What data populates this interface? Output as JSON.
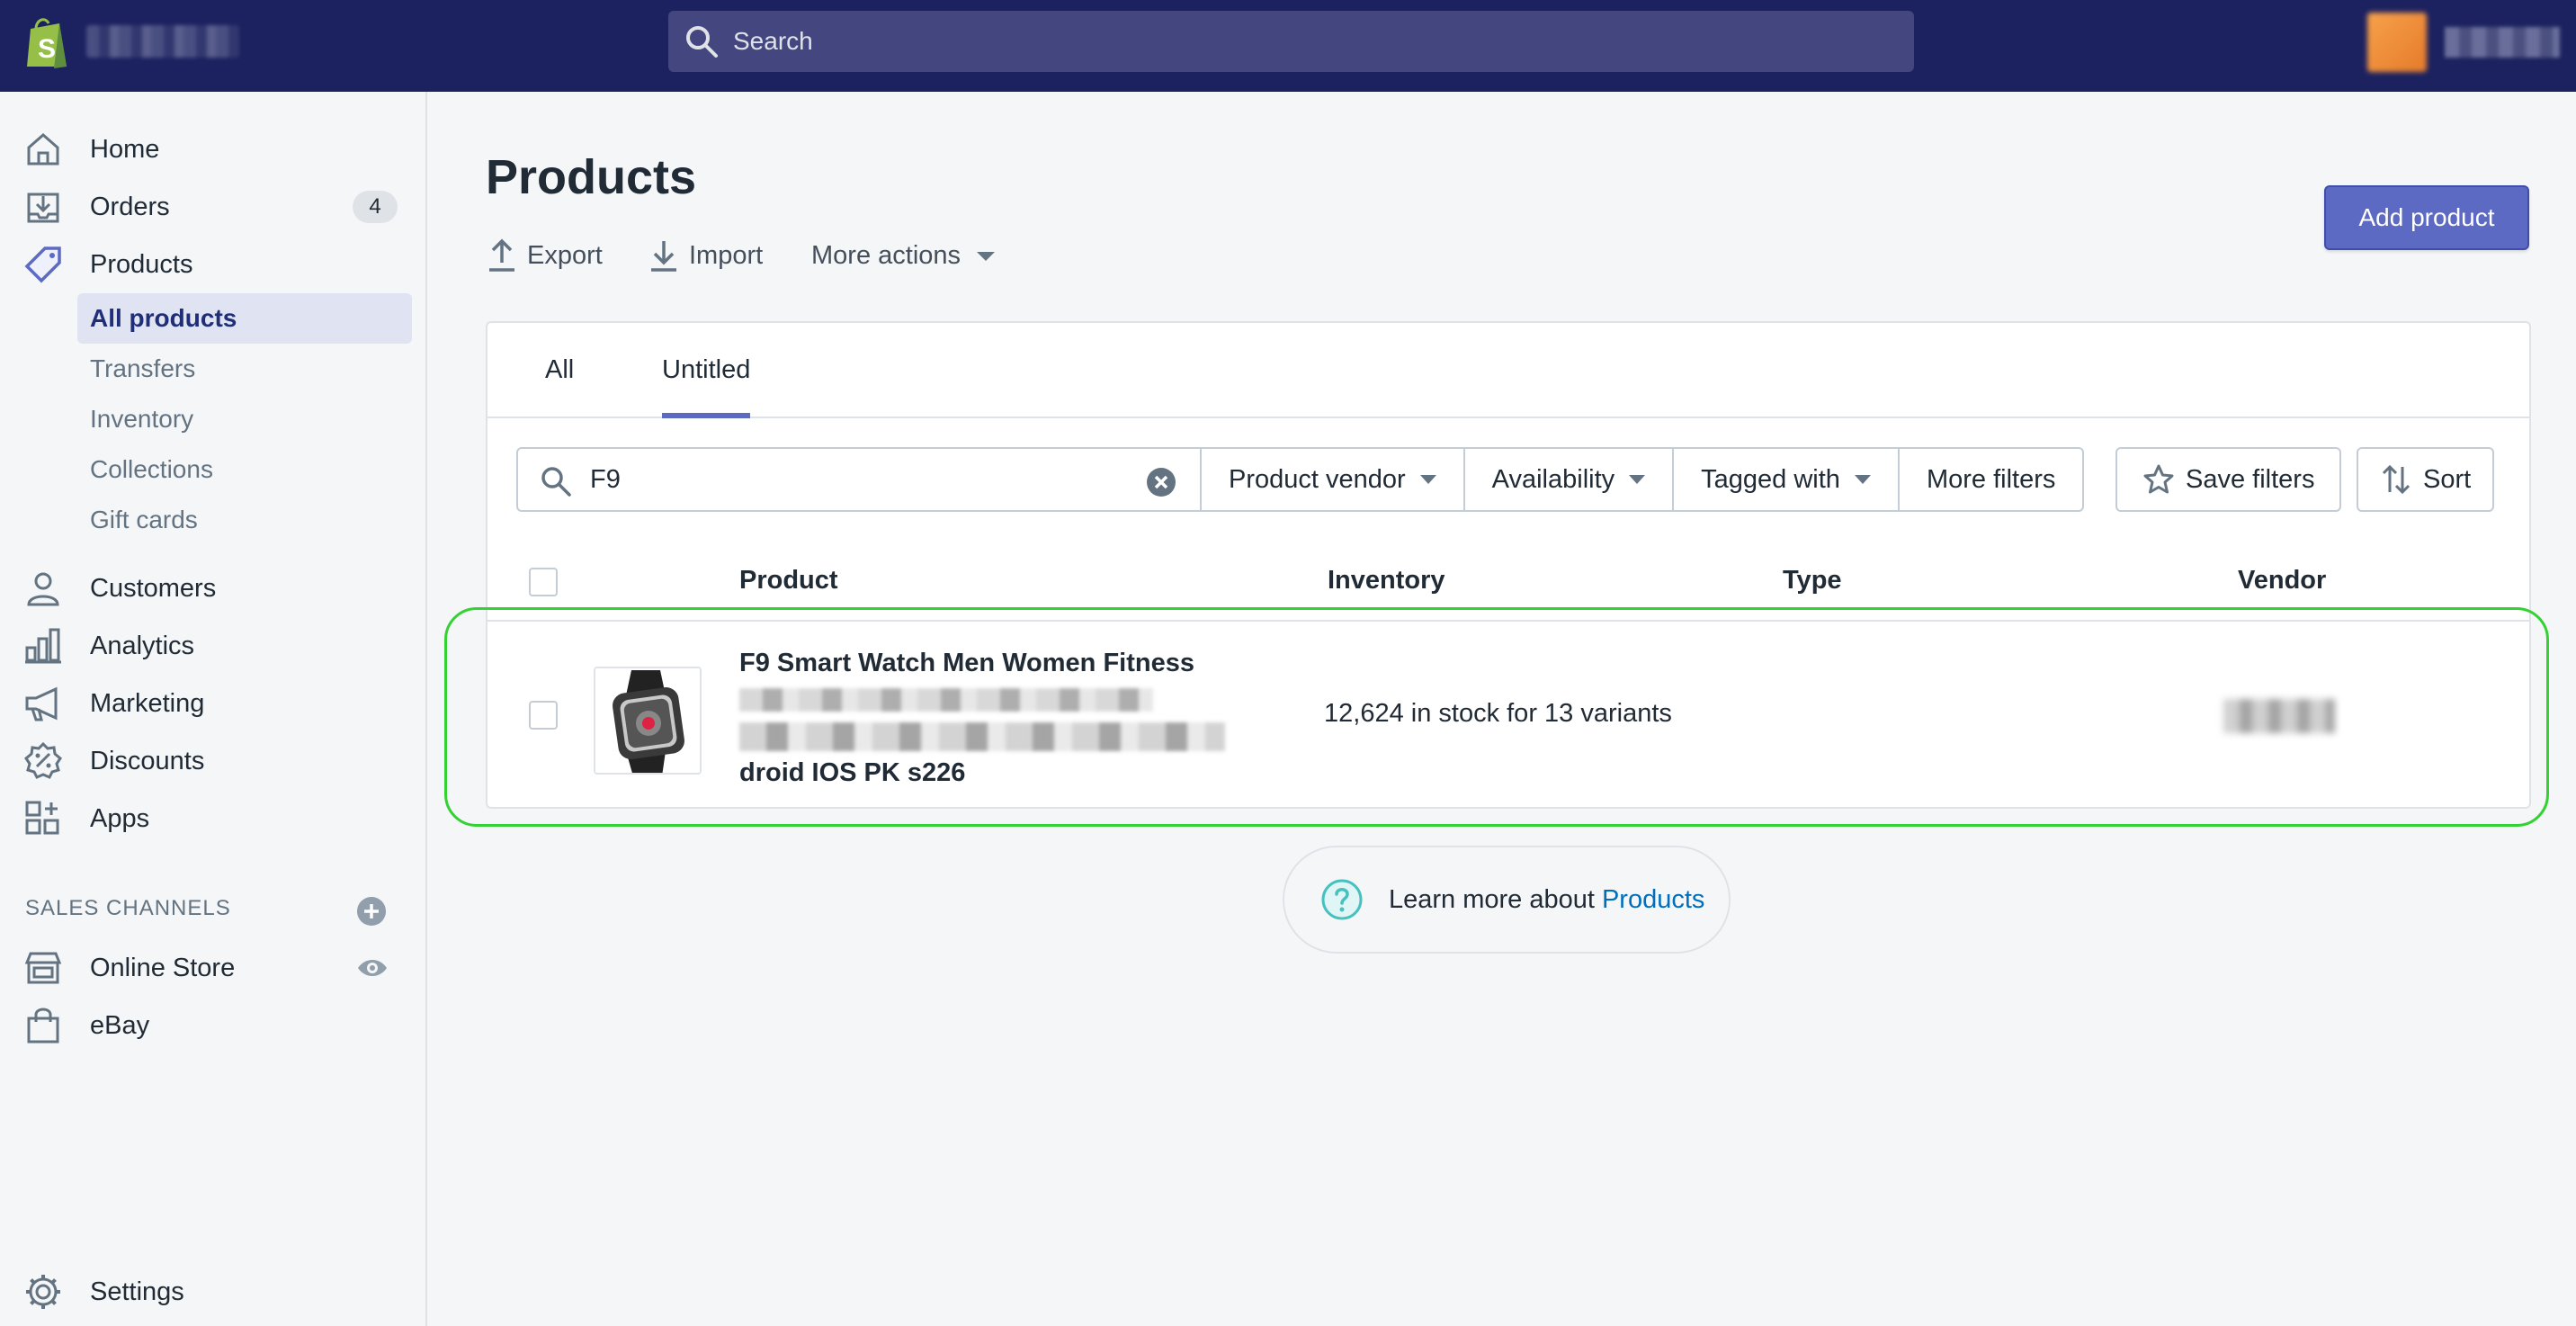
{
  "colors": {
    "topbar": "#1c2260",
    "accent": "#5c6ac4",
    "highlight": "#34d133",
    "link": "#006fbb"
  },
  "topbar": {
    "search_placeholder": "Search"
  },
  "sidebar": {
    "items": [
      {
        "label": "Home",
        "icon": "home-icon"
      },
      {
        "label": "Orders",
        "icon": "orders-icon",
        "badge": "4"
      },
      {
        "label": "Products",
        "icon": "tag-icon"
      },
      {
        "label": "Customers",
        "icon": "customer-icon"
      },
      {
        "label": "Analytics",
        "icon": "analytics-icon"
      },
      {
        "label": "Marketing",
        "icon": "megaphone-icon"
      },
      {
        "label": "Discounts",
        "icon": "discount-icon"
      },
      {
        "label": "Apps",
        "icon": "apps-icon"
      }
    ],
    "product_subitems": [
      "All products",
      "Transfers",
      "Inventory",
      "Collections",
      "Gift cards"
    ],
    "sales_channels_title": "SALES CHANNELS",
    "channels": [
      {
        "label": "Online Store",
        "icon": "store-icon"
      },
      {
        "label": "eBay",
        "icon": "bag-icon"
      }
    ],
    "settings_label": "Settings"
  },
  "main": {
    "title": "Products",
    "actions": {
      "export": "Export",
      "import": "Import",
      "more": "More actions"
    },
    "add_button": "Add product",
    "tabs": [
      "All",
      "Untitled"
    ],
    "filter": {
      "search_value": "F9",
      "buttons": [
        "Product vendor",
        "Availability",
        "Tagged with",
        "More filters"
      ],
      "save_filters": "Save filters",
      "sort": "Sort"
    },
    "table": {
      "headers": [
        "Product",
        "Inventory",
        "Type",
        "Vendor"
      ],
      "rows": [
        {
          "title_line1": "F9 Smart Watch Men Women Fitness",
          "title_line3": "droid IOS PK s226",
          "inventory": "12,624 in stock for 13 variants",
          "type": ""
        }
      ]
    },
    "learn_more": {
      "text": "Learn more about",
      "link": "Products"
    }
  }
}
